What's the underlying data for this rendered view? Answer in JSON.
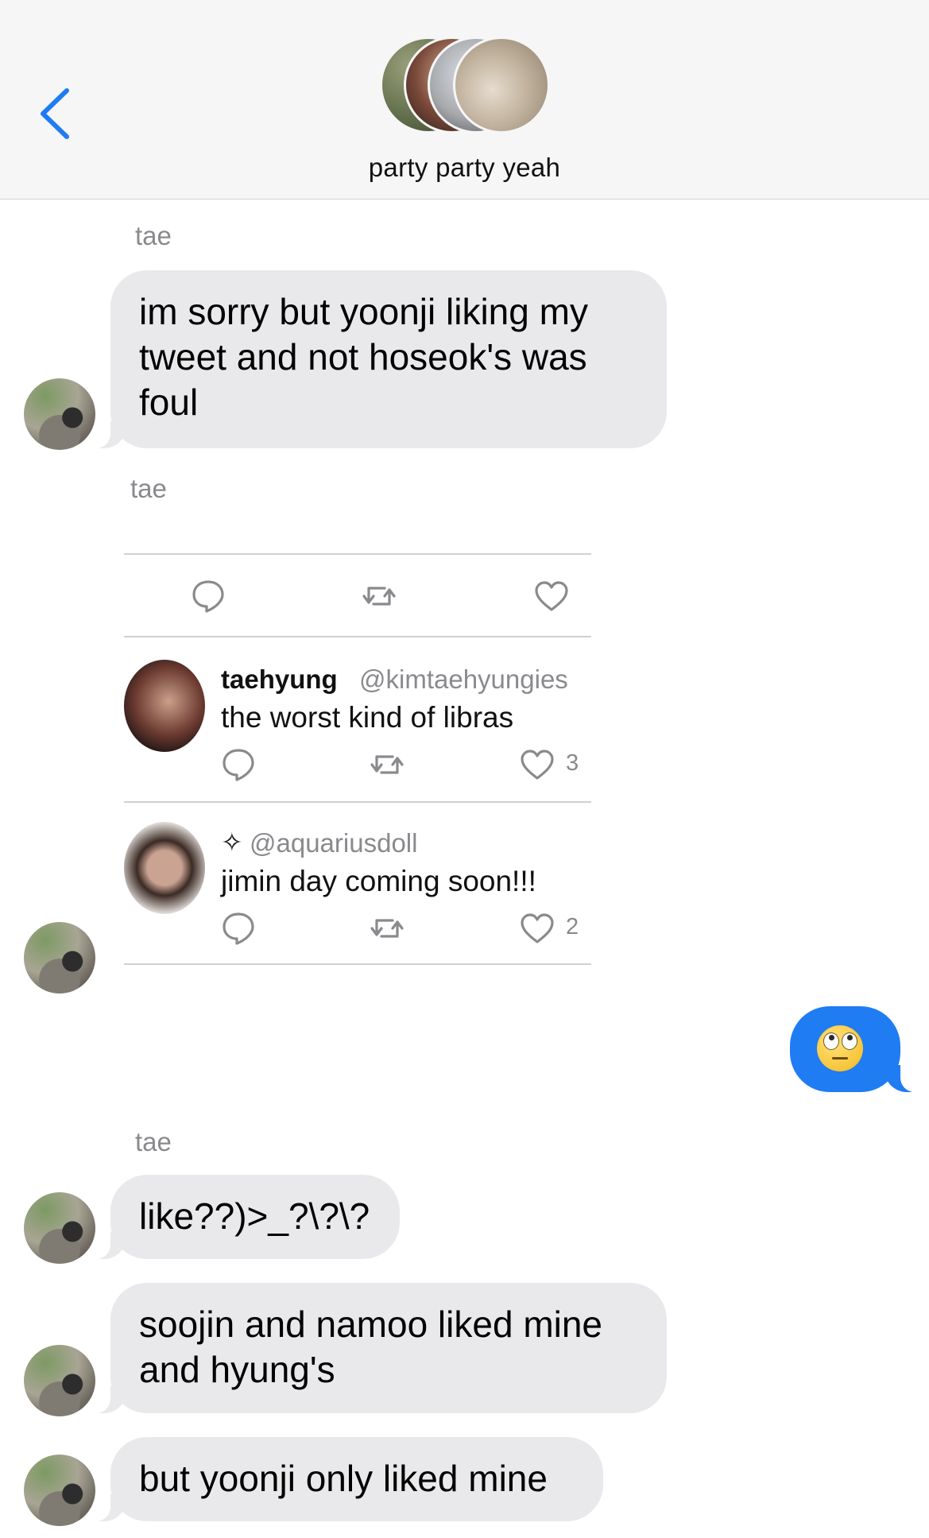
{
  "header": {
    "back_icon": "chevron-left-icon",
    "group_avatars": [
      "group-avatar-1",
      "group-avatar-2",
      "group-avatar-3",
      "group-avatar-4"
    ],
    "title": "party party yeah"
  },
  "colors": {
    "accent": "#1f7cf2",
    "incoming_bubble": "#e9e9eb",
    "sender_gray": "#8a8a8e",
    "header_bg": "#f6f6f7"
  },
  "messages": [
    {
      "sender": "tae",
      "lines": [
        "im sorry but yoonji liking my",
        "tweet and not hoseok's was",
        "foul"
      ]
    },
    {
      "sender": "tae",
      "type": "tweet-share"
    },
    {
      "sender": "me",
      "emoji": "face-with-rolling-eyes"
    },
    {
      "sender": "tae",
      "lines": [
        "like??)>_?\\?\\?"
      ]
    },
    {
      "lines": [
        "soojin and namoo liked mine",
        "and hyung's"
      ]
    },
    {
      "lines": [
        "but yoonji only liked mine"
      ]
    }
  ],
  "tweet": {
    "actions": [
      "reply-icon",
      "retweet-icon",
      "like-icon"
    ],
    "replies": [
      {
        "name": "taehyung",
        "handle": "@kimtaehyungies",
        "text": "the worst kind of libras",
        "likes": "3"
      },
      {
        "name": "✧",
        "handle": "@aquariusdoll",
        "text": "jimin day coming soon!!!",
        "likes": "2"
      }
    ]
  }
}
